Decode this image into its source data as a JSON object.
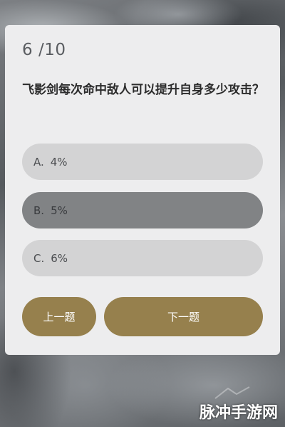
{
  "quiz": {
    "progress": "6 /10",
    "question": "飞影剑每次命中敌人可以提升自身多少攻击？",
    "options": [
      {
        "letter": "A.",
        "value": "4%"
      },
      {
        "letter": "B.",
        "value": "5%"
      },
      {
        "letter": "C.",
        "value": "6%"
      }
    ],
    "selected_option": "B",
    "prev_label": "上一题",
    "next_label": "下一题"
  },
  "watermark": {
    "text": "脉冲手游网"
  },
  "colors": {
    "accent": "#96804d",
    "card_bg": "#ededee",
    "option_bg": "#d3d3d4",
    "option_selected_bg": "#818385"
  }
}
